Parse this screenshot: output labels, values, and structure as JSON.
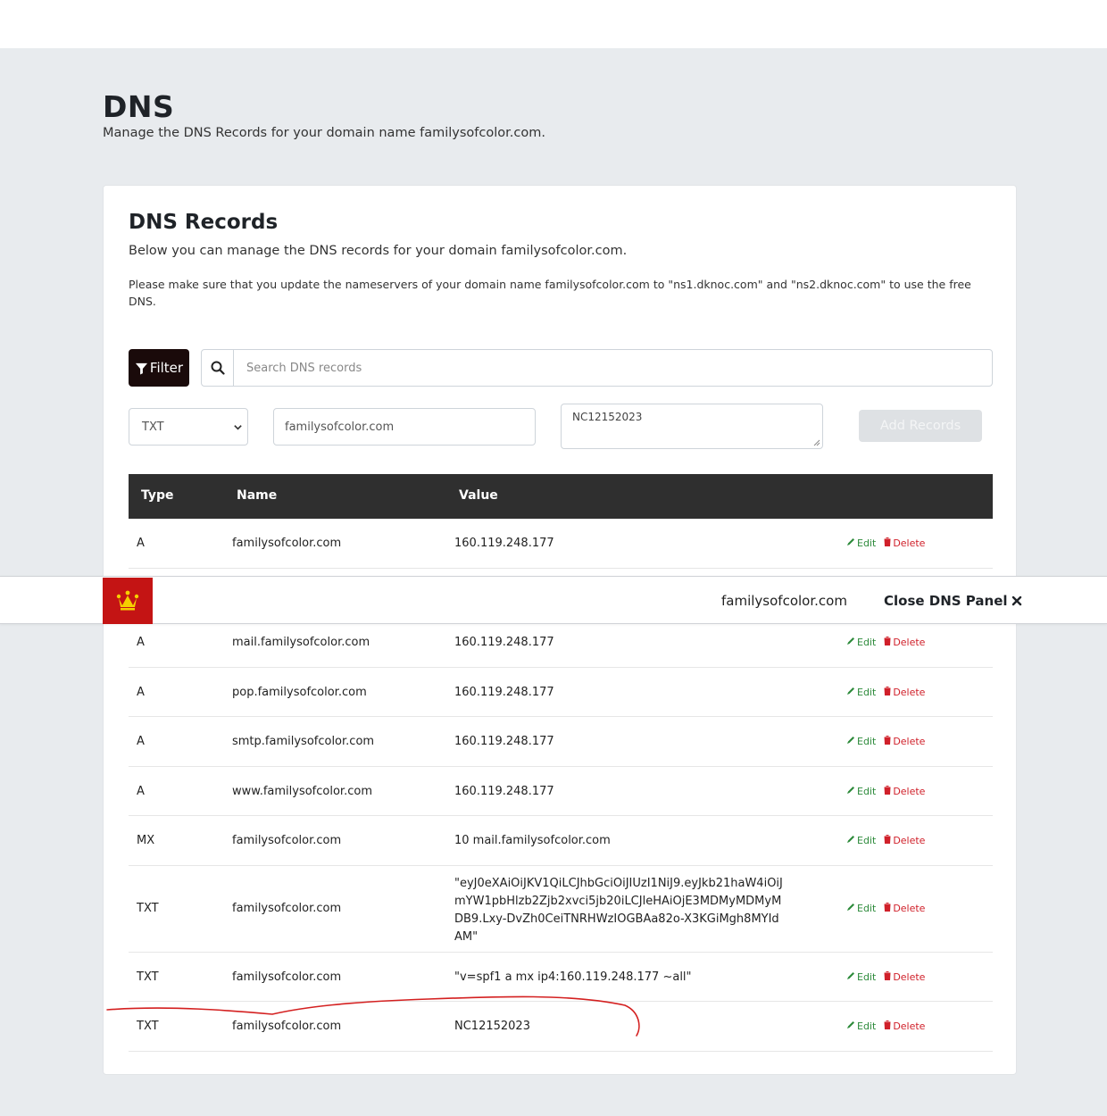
{
  "page": {
    "title": "DNS",
    "subtitle": "Manage the DNS Records for your domain name familysofcolor.com."
  },
  "card": {
    "title": "DNS Records",
    "subtitle": "Below you can manage the DNS records for your domain familysofcolor.com.",
    "note": "Please make sure that you update the nameservers of your domain name familysofcolor.com to \"ns1.dknoc.com\" and \"ns2.dknoc.com\" to use the free DNS."
  },
  "toolbar": {
    "filter_label": "Filter",
    "search_placeholder": "Search DNS records"
  },
  "add_form": {
    "type_value": "TXT",
    "name_value": "familysofcolor.com",
    "value_value": "NC12152023",
    "add_label": "Add Records"
  },
  "table": {
    "headers": {
      "type": "Type",
      "name": "Name",
      "value": "Value"
    },
    "edit_label": "Edit",
    "delete_label": "Delete",
    "rows": [
      {
        "type": "A",
        "name": "familysofcolor.com",
        "value": "160.119.248.177"
      },
      {
        "type": "",
        "name": "",
        "value": ""
      },
      {
        "type": "A",
        "name": "mail.familysofcolor.com",
        "value": "160.119.248.177"
      },
      {
        "type": "A",
        "name": "pop.familysofcolor.com",
        "value": "160.119.248.177"
      },
      {
        "type": "A",
        "name": "smtp.familysofcolor.com",
        "value": "160.119.248.177"
      },
      {
        "type": "A",
        "name": "www.familysofcolor.com",
        "value": "160.119.248.177"
      },
      {
        "type": "MX",
        "name": "familysofcolor.com",
        "value": "10 mail.familysofcolor.com"
      },
      {
        "type": "TXT",
        "name": "familysofcolor.com",
        "value": "\"eyJ0eXAiOiJKV1QiLCJhbGciOiJIUzI1NiJ9.eyJkb21haW4iOiJmYW1pbHlzb2Zjb2xvci5jb20iLCJleHAiOjE3MDMyMDMyMDB9.Lxy-DvZh0CeiTNRHWzIOGBAa82o-X3KGiMgh8MYIdAM\""
      },
      {
        "type": "TXT",
        "name": "familysofcolor.com",
        "value": "\"v=spf1 a mx ip4:160.119.248.177 ~all\""
      },
      {
        "type": "TXT",
        "name": "familysofcolor.com",
        "value": "NC12152023"
      }
    ]
  },
  "panel": {
    "domain": "familysofcolor.com",
    "close_label": "Close DNS Panel",
    "logo_icon": "crown-icon"
  },
  "colors": {
    "header_bg": "#2f2f2f",
    "filter_bg": "#1a0a0a",
    "edit": "#2c8a3a",
    "delete": "#d0202a",
    "brand": "#c41414",
    "annotation": "#d42020"
  }
}
